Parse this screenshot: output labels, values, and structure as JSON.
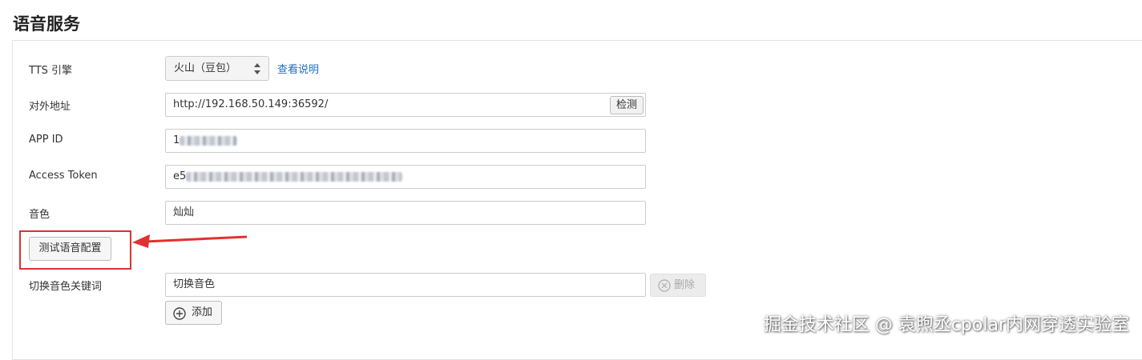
{
  "section": {
    "title": "语音服务"
  },
  "tts_engine": {
    "label": "TTS 引擎",
    "value": "火山（豆包）",
    "help_link": "查看说明"
  },
  "external_address": {
    "label": "对外地址",
    "value": "http://192.168.50.149:36592/",
    "detect_button": "检测"
  },
  "app_id": {
    "label": "APP ID",
    "value_visible": "1"
  },
  "access_token": {
    "label": "Access Token",
    "value_visible": "e5"
  },
  "voice": {
    "label": "音色",
    "value": "灿灿"
  },
  "test_button": {
    "label": "测试语音配置"
  },
  "switch_keyword": {
    "label": "切换音色关键词",
    "value": "切换音色",
    "delete_button": "删除",
    "add_button": "添加"
  },
  "annotation": {
    "highlight_color": "#e03131"
  },
  "watermark": {
    "text": "掘金技术社区 @ 袁煦丞cpolar内网穿透实验室"
  }
}
